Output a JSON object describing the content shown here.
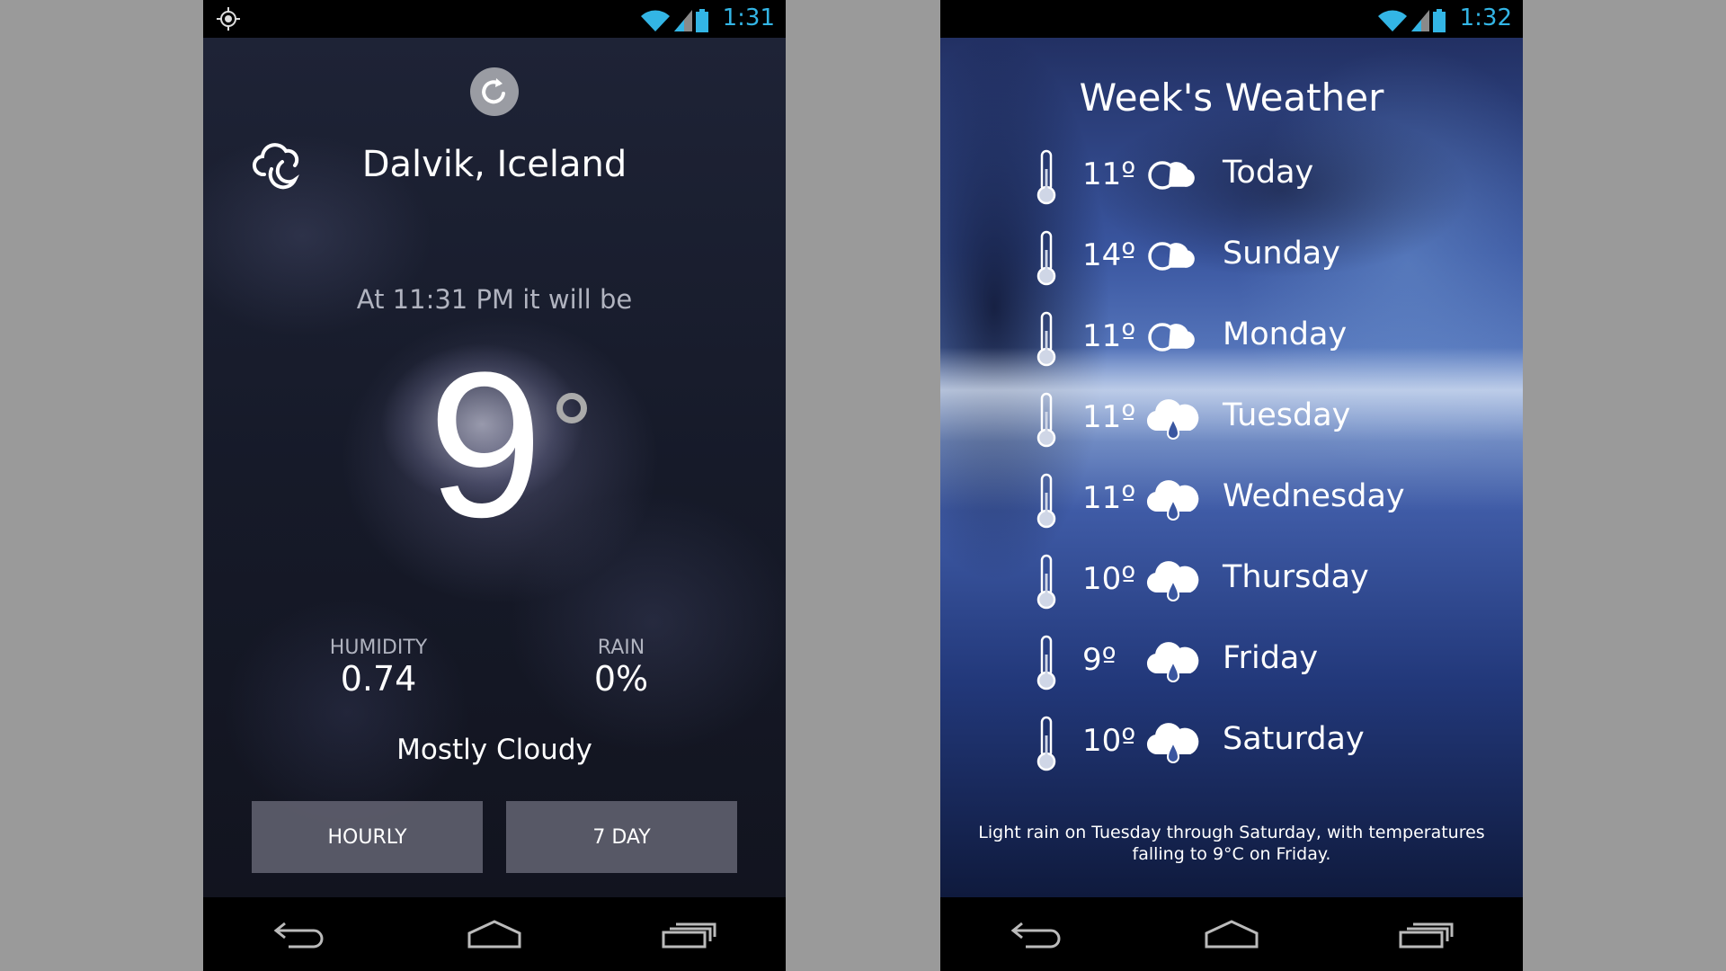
{
  "left_screen": {
    "status": {
      "time": "1:31"
    },
    "location": "Dalvik, Iceland",
    "forecast_intro": "At 11:31 PM it will be",
    "temperature": "9",
    "humidity": {
      "label": "HUMIDITY",
      "value": "0.74"
    },
    "rain": {
      "label": "RAIN",
      "value": "0%"
    },
    "condition": "Mostly Cloudy",
    "buttons": {
      "hourly": "HOURLY",
      "seven_day": "7 DAY"
    }
  },
  "right_screen": {
    "status": {
      "time": "1:32"
    },
    "title": "Week's Weather",
    "days": [
      {
        "temp": "11º",
        "day": "Today",
        "icon": "partly-cloudy-icon"
      },
      {
        "temp": "14º",
        "day": "Sunday",
        "icon": "partly-cloudy-icon"
      },
      {
        "temp": "11º",
        "day": "Monday",
        "icon": "partly-cloudy-icon"
      },
      {
        "temp": "11º",
        "day": "Tuesday",
        "icon": "rain-cloud-icon"
      },
      {
        "temp": "11º",
        "day": "Wednesday",
        "icon": "rain-cloud-icon"
      },
      {
        "temp": "10º",
        "day": "Thursday",
        "icon": "rain-cloud-icon"
      },
      {
        "temp": "9º",
        "day": "Friday",
        "icon": "rain-cloud-icon"
      },
      {
        "temp": "10º",
        "day": "Saturday",
        "icon": "rain-cloud-icon"
      }
    ],
    "summary": "Light rain on Tuesday through Saturday, with temperatures falling to 9°C on Friday."
  },
  "colors": {
    "status_accent": "#33b5e5",
    "page_background": "#9a9a9a",
    "button_fill": "#696978"
  }
}
